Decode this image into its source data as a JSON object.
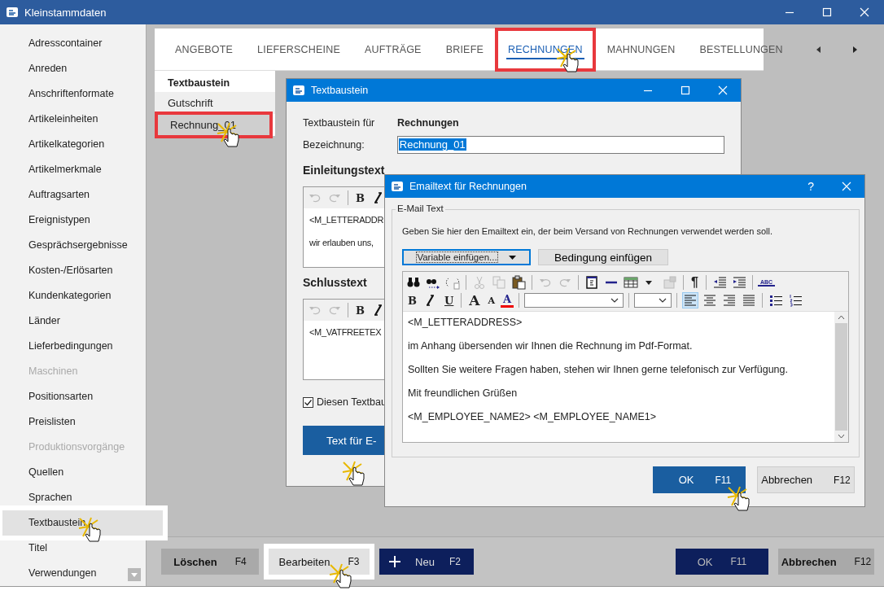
{
  "window": {
    "title": "Kleinstammdaten"
  },
  "sidebar": {
    "items": [
      {
        "label": "Adresscontainer",
        "selected": false,
        "disabled": false
      },
      {
        "label": "Anreden",
        "selected": false,
        "disabled": false
      },
      {
        "label": "Anschriftenformate",
        "selected": false,
        "disabled": false
      },
      {
        "label": "Artikeleinheiten",
        "selected": false,
        "disabled": false
      },
      {
        "label": "Artikelkategorien",
        "selected": false,
        "disabled": false
      },
      {
        "label": "Artikelmerkmale",
        "selected": false,
        "disabled": false
      },
      {
        "label": "Auftragsarten",
        "selected": false,
        "disabled": false
      },
      {
        "label": "Ereignistypen",
        "selected": false,
        "disabled": false
      },
      {
        "label": "Gesprächsergebnisse",
        "selected": false,
        "disabled": false
      },
      {
        "label": "Kosten-/Erlösarten",
        "selected": false,
        "disabled": false
      },
      {
        "label": "Kundenkategorien",
        "selected": false,
        "disabled": false
      },
      {
        "label": "Länder",
        "selected": false,
        "disabled": false
      },
      {
        "label": "Lieferbedingungen",
        "selected": false,
        "disabled": false
      },
      {
        "label": "Maschinen",
        "selected": false,
        "disabled": true
      },
      {
        "label": "Positionsarten",
        "selected": false,
        "disabled": false
      },
      {
        "label": "Preislisten",
        "selected": false,
        "disabled": false
      },
      {
        "label": "Produktionsvorgänge",
        "selected": false,
        "disabled": true
      },
      {
        "label": "Quellen",
        "selected": false,
        "disabled": false
      },
      {
        "label": "Sprachen",
        "selected": false,
        "disabled": false
      },
      {
        "label": "Textbaustein",
        "selected": true,
        "disabled": false
      },
      {
        "label": "Titel",
        "selected": false,
        "disabled": false
      },
      {
        "label": "Verwendungen",
        "selected": false,
        "disabled": false
      }
    ]
  },
  "tabs": [
    {
      "label": "ANGEBOTE",
      "selected": false,
      "marked": false
    },
    {
      "label": "LIEFERSCHEINE",
      "selected": false,
      "marked": false
    },
    {
      "label": "AUFTRÄGE",
      "selected": false,
      "marked": false
    },
    {
      "label": "BRIEFE",
      "selected": false,
      "marked": false
    },
    {
      "label": "RECHNUNGEN",
      "selected": true,
      "marked": true
    },
    {
      "label": "MAHNUNGEN",
      "selected": false,
      "marked": false
    },
    {
      "label": "BESTELLUNGEN",
      "selected": false,
      "marked": false
    }
  ],
  "list": {
    "header": "Textbaustein",
    "items": [
      {
        "label": "Gutschrift",
        "selected": false,
        "marked": false
      },
      {
        "label": "Rechnung_01",
        "selected": true,
        "marked": true
      }
    ]
  },
  "textbaustein_dialog": {
    "title": "Textbaustein",
    "for_label": "Textbaustein für",
    "for_value": "Rechnungen",
    "name_label": "Bezeichnung:",
    "name_value": "Rechnung_01",
    "editors": [
      {
        "heading": "Einleitungstext",
        "toolbar": [
          {
            "kind": "undo"
          },
          {
            "kind": "redo"
          },
          {
            "kind": "sep"
          },
          {
            "kind": "bold",
            "label": "B"
          },
          {
            "kind": "italic"
          }
        ],
        "lines": [
          "<M_LETTERADDR",
          "wir erlauben uns,"
        ]
      },
      {
        "heading": "Schlusstext",
        "toolbar": [
          {
            "kind": "undo"
          },
          {
            "kind": "redo"
          },
          {
            "kind": "sep"
          },
          {
            "kind": "bold",
            "label": "B"
          },
          {
            "kind": "italic"
          }
        ],
        "lines": [
          "<M_VATFREETEX"
        ]
      }
    ],
    "checkbox": {
      "label": "Diesen Textbau",
      "checked": true
    },
    "email_button": "Text für E-"
  },
  "email_dialog": {
    "title": "Emailtext für Rechnungen",
    "help": "?",
    "group": "E-Mail Text",
    "description": "Geben Sie hier den Emailtext ein, der beim Versand von Rechnungen verwendet werden soll.",
    "variable_dropdown": "Variable einfügen...",
    "condition_button": "Bedingung einfügen",
    "toolbar_rows": [
      [
        {
          "kind": "find"
        },
        {
          "kind": "findnext"
        },
        {
          "kind": "replace"
        },
        {
          "kind": "sep"
        },
        {
          "kind": "cut"
        },
        {
          "kind": "copy"
        },
        {
          "kind": "paste"
        },
        {
          "kind": "sep"
        },
        {
          "kind": "undo"
        },
        {
          "kind": "redo"
        },
        {
          "kind": "sep"
        },
        {
          "kind": "field"
        },
        {
          "kind": "hline"
        },
        {
          "kind": "table"
        },
        {
          "kind": "caret"
        },
        {
          "kind": "tableprops"
        },
        {
          "kind": "sep"
        },
        {
          "kind": "pilcrow",
          "label": "¶"
        },
        {
          "kind": "sep"
        },
        {
          "kind": "outdent"
        },
        {
          "kind": "indent"
        },
        {
          "kind": "sep"
        },
        {
          "kind": "spell",
          "label": "ABC"
        }
      ],
      [
        {
          "kind": "bold",
          "label": "B"
        },
        {
          "kind": "italic"
        },
        {
          "kind": "underline",
          "label": "U"
        },
        {
          "kind": "sep"
        },
        {
          "kind": "grow",
          "label": "A"
        },
        {
          "kind": "shrink",
          "label": "A"
        },
        {
          "kind": "color",
          "label": "A"
        },
        {
          "kind": "sep"
        },
        {
          "kind": "fontselect"
        },
        {
          "kind": "sep"
        },
        {
          "kind": "sizeselect"
        },
        {
          "kind": "sep"
        },
        {
          "kind": "alignleft",
          "on": true
        },
        {
          "kind": "aligncenter",
          "on": false
        },
        {
          "kind": "alignright",
          "on": false
        },
        {
          "kind": "justify",
          "on": false
        },
        {
          "kind": "sep"
        },
        {
          "kind": "bullets"
        },
        {
          "kind": "numbers"
        }
      ]
    ],
    "lines": [
      "<M_LETTERADDRESS>",
      "im Anhang übersenden wir Ihnen die Rechnung im Pdf-Format.",
      "Sollten Sie weitere Fragen haben, stehen wir Ihnen gerne telefonisch zur Verfügung.",
      "Mit freundlichen Grüßen",
      "<M_EMPLOYEE_NAME2> <M_EMPLOYEE_NAME1>"
    ],
    "buttons": [
      {
        "kind": "primary",
        "label": "OK",
        "key": "F11"
      },
      {
        "kind": "secondary",
        "label": "Abbrechen",
        "key": "F12"
      }
    ]
  },
  "bottom_bar": {
    "buttons": [
      {
        "kind": "grey",
        "label": "Löschen",
        "key": "F4"
      },
      {
        "kind": "light",
        "label": "Bearbeiten",
        "key": "F3"
      },
      {
        "kind": "add",
        "label": "Neu",
        "key": "F2"
      },
      {
        "kind": "spacer"
      },
      {
        "kind": "navy",
        "label": "OK",
        "key": "F11"
      },
      {
        "kind": "grey",
        "label": "Abbrechen",
        "key": "F12"
      }
    ]
  }
}
